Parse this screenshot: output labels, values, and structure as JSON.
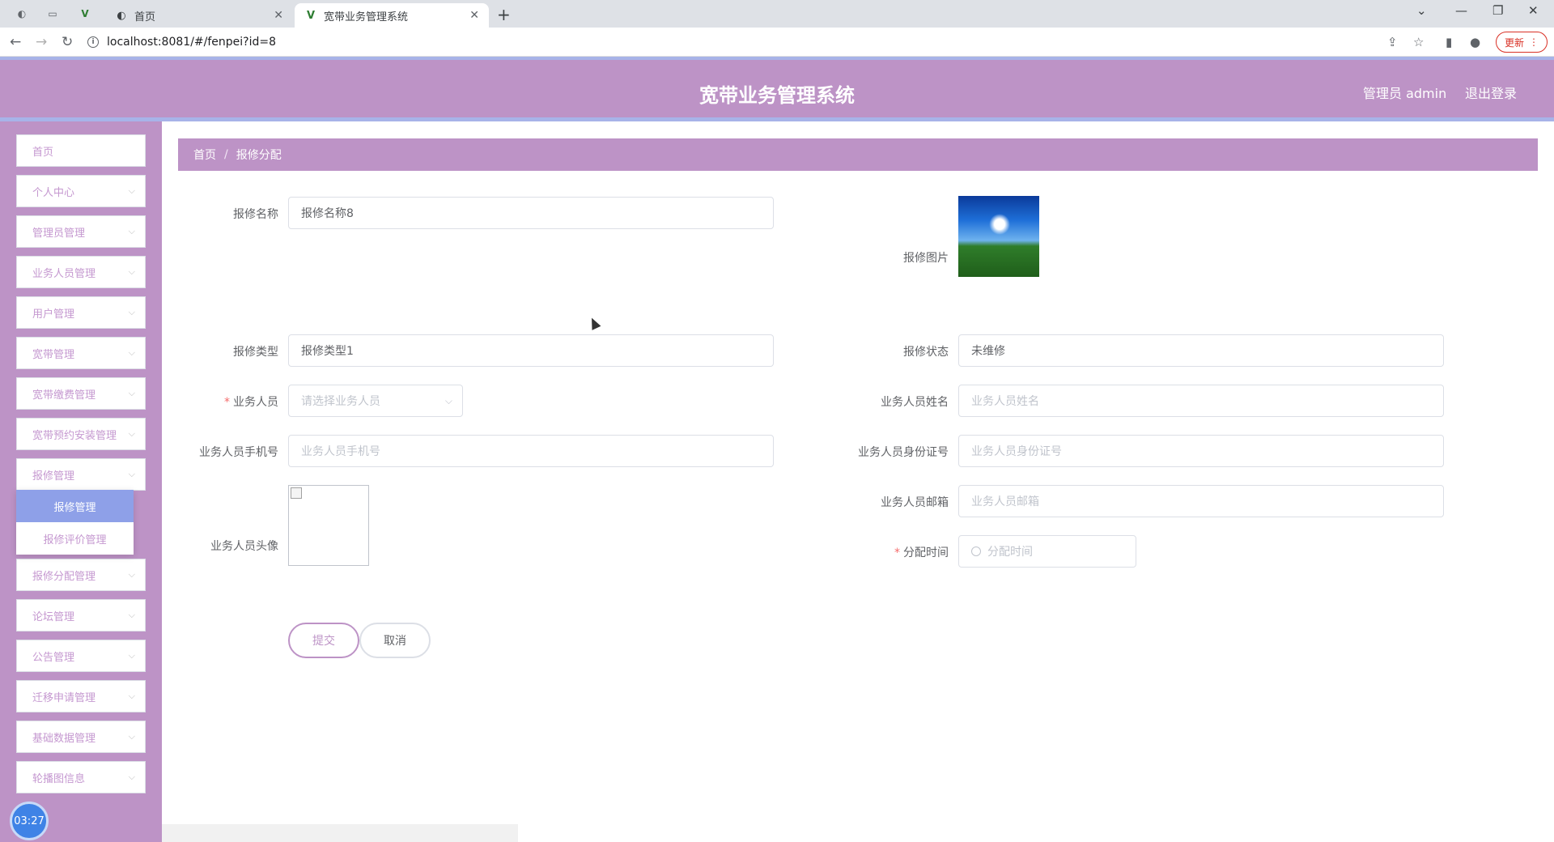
{
  "browser": {
    "tabs": [
      {
        "title": "首页",
        "active": false
      },
      {
        "title": "宽带业务管理系统",
        "active": true
      }
    ],
    "url": "localhost:8081/#/fenpei?id=8",
    "update_label": "更新"
  },
  "header": {
    "title": "宽带业务管理系统",
    "user": "管理员 admin",
    "logout": "退出登录"
  },
  "sidebar": {
    "items": [
      {
        "label": "首页"
      },
      {
        "label": "个人中心"
      },
      {
        "label": "管理员管理"
      },
      {
        "label": "业务人员管理"
      },
      {
        "label": "用户管理"
      },
      {
        "label": "宽带管理"
      },
      {
        "label": "宽带缴费管理"
      },
      {
        "label": "宽带预约安装管理"
      },
      {
        "label": "报修管理"
      },
      {
        "label": "报修分配管理"
      },
      {
        "label": "论坛管理"
      },
      {
        "label": "公告管理"
      },
      {
        "label": "迁移申请管理"
      },
      {
        "label": "基础数据管理"
      },
      {
        "label": "轮播图信息"
      }
    ],
    "submenu": [
      {
        "label": "报修管理",
        "active": true
      },
      {
        "label": "报修评价管理",
        "active": false
      }
    ],
    "clock": "03:27"
  },
  "breadcrumb": {
    "home": "首页",
    "current": "报修分配"
  },
  "form": {
    "repair_name": {
      "label": "报修名称",
      "value": "报修名称8"
    },
    "repair_image": {
      "label": "报修图片"
    },
    "repair_type": {
      "label": "报修类型",
      "value": "报修类型1"
    },
    "repair_status": {
      "label": "报修状态",
      "value": "未维修"
    },
    "staff": {
      "label": "业务人员",
      "placeholder": "请选择业务人员",
      "required": true
    },
    "staff_name": {
      "label": "业务人员姓名",
      "placeholder": "业务人员姓名"
    },
    "staff_phone": {
      "label": "业务人员手机号",
      "placeholder": "业务人员手机号"
    },
    "staff_id": {
      "label": "业务人员身份证号",
      "placeholder": "业务人员身份证号"
    },
    "staff_avatar": {
      "label": "业务人员头像"
    },
    "staff_email": {
      "label": "业务人员邮箱",
      "placeholder": "业务人员邮箱"
    },
    "assign_time": {
      "label": "分配时间",
      "placeholder": "分配时间",
      "required": true
    },
    "submit": "提交",
    "cancel": "取消"
  },
  "colors": {
    "accent": "#bd93c6",
    "header_border": "#a7b3e8",
    "submenu_active": "#8ea0e8"
  }
}
